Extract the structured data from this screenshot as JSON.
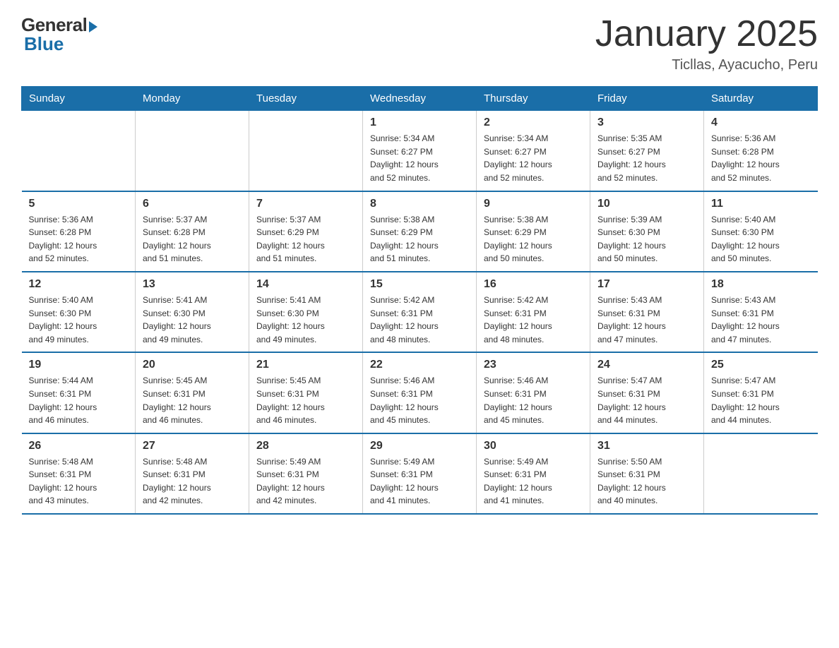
{
  "header": {
    "logo_general": "General",
    "logo_blue": "Blue",
    "month_title": "January 2025",
    "location": "Ticllas, Ayacucho, Peru"
  },
  "days_of_week": [
    "Sunday",
    "Monday",
    "Tuesday",
    "Wednesday",
    "Thursday",
    "Friday",
    "Saturday"
  ],
  "weeks": [
    [
      {
        "day": "",
        "info": ""
      },
      {
        "day": "",
        "info": ""
      },
      {
        "day": "",
        "info": ""
      },
      {
        "day": "1",
        "info": "Sunrise: 5:34 AM\nSunset: 6:27 PM\nDaylight: 12 hours\nand 52 minutes."
      },
      {
        "day": "2",
        "info": "Sunrise: 5:34 AM\nSunset: 6:27 PM\nDaylight: 12 hours\nand 52 minutes."
      },
      {
        "day": "3",
        "info": "Sunrise: 5:35 AM\nSunset: 6:27 PM\nDaylight: 12 hours\nand 52 minutes."
      },
      {
        "day": "4",
        "info": "Sunrise: 5:36 AM\nSunset: 6:28 PM\nDaylight: 12 hours\nand 52 minutes."
      }
    ],
    [
      {
        "day": "5",
        "info": "Sunrise: 5:36 AM\nSunset: 6:28 PM\nDaylight: 12 hours\nand 52 minutes."
      },
      {
        "day": "6",
        "info": "Sunrise: 5:37 AM\nSunset: 6:28 PM\nDaylight: 12 hours\nand 51 minutes."
      },
      {
        "day": "7",
        "info": "Sunrise: 5:37 AM\nSunset: 6:29 PM\nDaylight: 12 hours\nand 51 minutes."
      },
      {
        "day": "8",
        "info": "Sunrise: 5:38 AM\nSunset: 6:29 PM\nDaylight: 12 hours\nand 51 minutes."
      },
      {
        "day": "9",
        "info": "Sunrise: 5:38 AM\nSunset: 6:29 PM\nDaylight: 12 hours\nand 50 minutes."
      },
      {
        "day": "10",
        "info": "Sunrise: 5:39 AM\nSunset: 6:30 PM\nDaylight: 12 hours\nand 50 minutes."
      },
      {
        "day": "11",
        "info": "Sunrise: 5:40 AM\nSunset: 6:30 PM\nDaylight: 12 hours\nand 50 minutes."
      }
    ],
    [
      {
        "day": "12",
        "info": "Sunrise: 5:40 AM\nSunset: 6:30 PM\nDaylight: 12 hours\nand 49 minutes."
      },
      {
        "day": "13",
        "info": "Sunrise: 5:41 AM\nSunset: 6:30 PM\nDaylight: 12 hours\nand 49 minutes."
      },
      {
        "day": "14",
        "info": "Sunrise: 5:41 AM\nSunset: 6:30 PM\nDaylight: 12 hours\nand 49 minutes."
      },
      {
        "day": "15",
        "info": "Sunrise: 5:42 AM\nSunset: 6:31 PM\nDaylight: 12 hours\nand 48 minutes."
      },
      {
        "day": "16",
        "info": "Sunrise: 5:42 AM\nSunset: 6:31 PM\nDaylight: 12 hours\nand 48 minutes."
      },
      {
        "day": "17",
        "info": "Sunrise: 5:43 AM\nSunset: 6:31 PM\nDaylight: 12 hours\nand 47 minutes."
      },
      {
        "day": "18",
        "info": "Sunrise: 5:43 AM\nSunset: 6:31 PM\nDaylight: 12 hours\nand 47 minutes."
      }
    ],
    [
      {
        "day": "19",
        "info": "Sunrise: 5:44 AM\nSunset: 6:31 PM\nDaylight: 12 hours\nand 46 minutes."
      },
      {
        "day": "20",
        "info": "Sunrise: 5:45 AM\nSunset: 6:31 PM\nDaylight: 12 hours\nand 46 minutes."
      },
      {
        "day": "21",
        "info": "Sunrise: 5:45 AM\nSunset: 6:31 PM\nDaylight: 12 hours\nand 46 minutes."
      },
      {
        "day": "22",
        "info": "Sunrise: 5:46 AM\nSunset: 6:31 PM\nDaylight: 12 hours\nand 45 minutes."
      },
      {
        "day": "23",
        "info": "Sunrise: 5:46 AM\nSunset: 6:31 PM\nDaylight: 12 hours\nand 45 minutes."
      },
      {
        "day": "24",
        "info": "Sunrise: 5:47 AM\nSunset: 6:31 PM\nDaylight: 12 hours\nand 44 minutes."
      },
      {
        "day": "25",
        "info": "Sunrise: 5:47 AM\nSunset: 6:31 PM\nDaylight: 12 hours\nand 44 minutes."
      }
    ],
    [
      {
        "day": "26",
        "info": "Sunrise: 5:48 AM\nSunset: 6:31 PM\nDaylight: 12 hours\nand 43 minutes."
      },
      {
        "day": "27",
        "info": "Sunrise: 5:48 AM\nSunset: 6:31 PM\nDaylight: 12 hours\nand 42 minutes."
      },
      {
        "day": "28",
        "info": "Sunrise: 5:49 AM\nSunset: 6:31 PM\nDaylight: 12 hours\nand 42 minutes."
      },
      {
        "day": "29",
        "info": "Sunrise: 5:49 AM\nSunset: 6:31 PM\nDaylight: 12 hours\nand 41 minutes."
      },
      {
        "day": "30",
        "info": "Sunrise: 5:49 AM\nSunset: 6:31 PM\nDaylight: 12 hours\nand 41 minutes."
      },
      {
        "day": "31",
        "info": "Sunrise: 5:50 AM\nSunset: 6:31 PM\nDaylight: 12 hours\nand 40 minutes."
      },
      {
        "day": "",
        "info": ""
      }
    ]
  ]
}
